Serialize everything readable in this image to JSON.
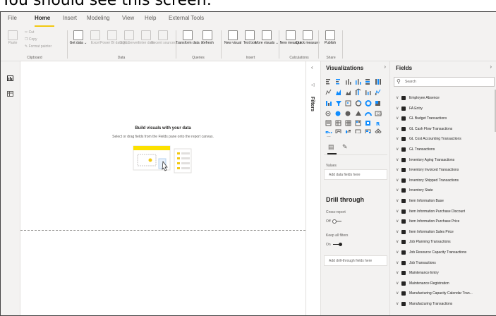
{
  "caption": "You should see this screen:",
  "menu": {
    "items": [
      "File",
      "Home",
      "Insert",
      "Modeling",
      "View",
      "Help",
      "External Tools"
    ],
    "active": "Home"
  },
  "ribbon": {
    "clipboard": {
      "paste": "Paste",
      "cut": "Cut",
      "copy": "Copy",
      "format_painter": "Format painter",
      "label": "Clipboard"
    },
    "data": {
      "get_data": "Get data ⌄",
      "excel": "Excel",
      "power_bi": "Power BI datasets",
      "sql": "SQL Server",
      "enter": "Enter data",
      "recent": "Recent sources ⌄",
      "label": "Data"
    },
    "queries": {
      "transform": "Transform data ⌄",
      "refresh": "Refresh",
      "label": "Queries"
    },
    "insert": {
      "new_visual": "New visual",
      "text_box": "Text box",
      "more_visuals": "More visuals ⌄",
      "label": "Insert"
    },
    "calculations": {
      "new_measure": "New measure",
      "quick_measure": "Quick measure",
      "label": "Calculations"
    },
    "share": {
      "publish": "Publish",
      "label": "Share"
    }
  },
  "canvas": {
    "title": "Build visuals with your data",
    "subtitle": "Select or drag fields from the Fields pane onto the report canvas."
  },
  "filters": {
    "label": "Filters"
  },
  "visualizations": {
    "title": "Visualizations",
    "values_label": "Values",
    "values_placeholder": "Add data fields here",
    "drill_title": "Drill through",
    "cross_report": "Cross-report",
    "cross_report_state": "Off",
    "keep_filters": "Keep all filters",
    "keep_filters_state": "On",
    "drill_placeholder": "Add drill-through fields here",
    "more": "..."
  },
  "fields": {
    "title": "Fields",
    "search_placeholder": "Search",
    "tables": [
      "Employee Absence",
      "FA Entry",
      "GL Budget Transactions",
      "GL Cash Flow Transactions",
      "GL Cost Accounting Transactions",
      "GL Transactions",
      "Inventory Aging Transactions",
      "Inventory Invoiced Transactions",
      "Inventory Shipped Transactions",
      "Inventory State",
      "Item Information Base",
      "Item Information Purchase Discount",
      "Item Information Purchase Price",
      "Item Information Sales Price",
      "Job Planning Transactions",
      "Job Resource Capacity Transactions",
      "Job Transactions",
      "Maintenance Entry",
      "Maintenance Registration",
      "Manufacturing Capacity Calendar Tran...",
      "Manufacturing Transactions"
    ]
  },
  "colors": {
    "accent": "#f2c811",
    "pane_bg": "#f3f2f1",
    "text": "#252423"
  }
}
